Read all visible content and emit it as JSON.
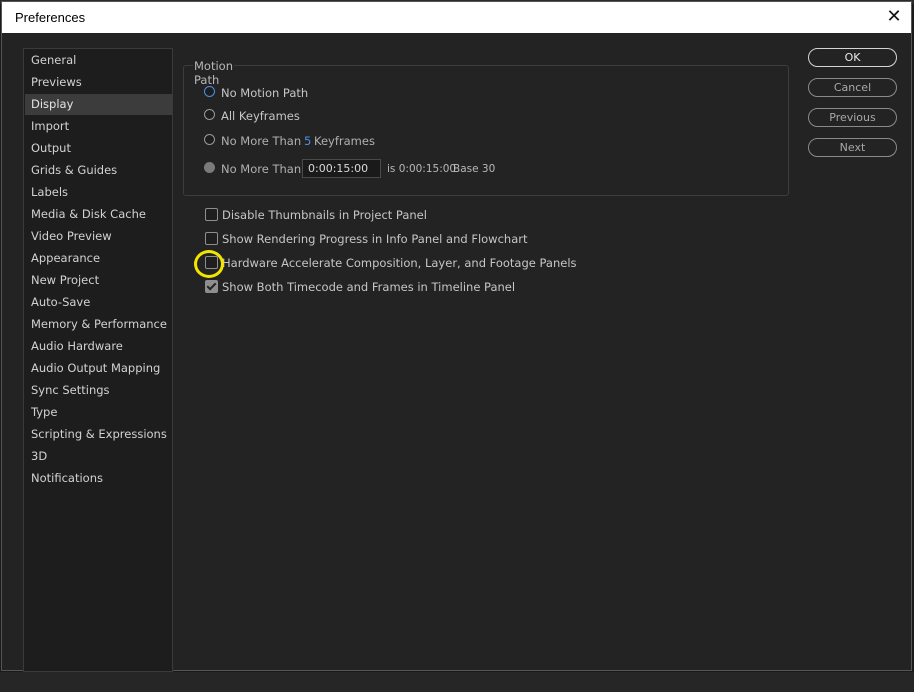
{
  "window": {
    "title": "Preferences",
    "close_glyph": "✕"
  },
  "sidebar": {
    "active": "Display",
    "items": [
      "General",
      "Previews",
      "Display",
      "Import",
      "Output",
      "Grids & Guides",
      "Labels",
      "Media & Disk Cache",
      "Video Preview",
      "Appearance",
      "New Project",
      "Auto-Save",
      "Memory & Performance",
      "Audio Hardware",
      "Audio Output Mapping",
      "Sync Settings",
      "Type",
      "Scripting & Expressions",
      "3D",
      "Notifications"
    ]
  },
  "motion_path": {
    "title": "Motion Path",
    "options": [
      {
        "label": "No Motion Path",
        "selected": true
      },
      {
        "label": "All Keyframes",
        "selected": false
      },
      {
        "label": "No More Than",
        "value": "5",
        "suffix": "Keyframes",
        "selected": false
      },
      {
        "label": "No More Than",
        "time_value": "0:00:15:00",
        "is_text": "is 0:00:15:00",
        "base_text": "Base 30",
        "selected": false
      }
    ]
  },
  "checkboxes": [
    {
      "label": "Disable Thumbnails in Project Panel",
      "checked": false
    },
    {
      "label": "Show Rendering Progress in Info Panel and Flowchart",
      "checked": false
    },
    {
      "label": "Hardware Accelerate Composition, Layer, and Footage Panels",
      "checked": false
    },
    {
      "label": "Show Both Timecode and Frames in Timeline Panel",
      "checked": true
    }
  ],
  "buttons": {
    "ok": "OK",
    "cancel": "Cancel",
    "previous": "Previous",
    "next": "Next"
  },
  "colors": {
    "accent": "#4d8fe6",
    "annotation": "#f2e600"
  }
}
